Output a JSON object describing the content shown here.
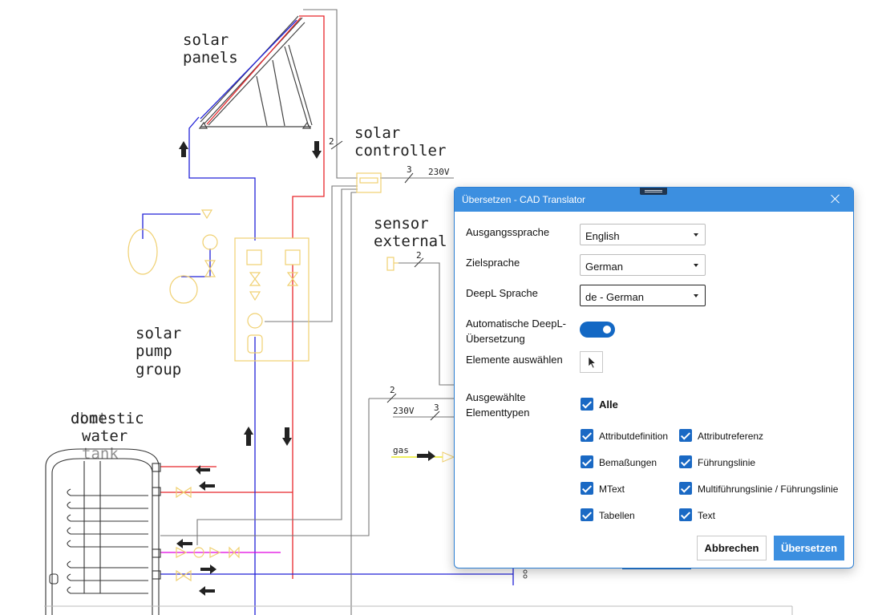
{
  "drawing": {
    "labels": {
      "solar_panels": [
        "solar",
        "panels"
      ],
      "solar_controller": [
        "solar",
        "controller"
      ],
      "sensor_external": [
        "sensor",
        "external"
      ],
      "solar_pump_group": [
        "solar",
        "pump",
        "group"
      ],
      "domestic_water_tank": [
        "domestic",
        "water",
        "tank"
      ],
      "overlap_text": "dbot"
    },
    "wire_marks": {
      "controller_wire_count": "2",
      "supply_wire_count": "3",
      "supply_voltage": "230V",
      "sensor_wire_count": "2",
      "lower_wire_count_a": "2",
      "lower_wire_count_b": "3",
      "lower_voltage": "230V",
      "gas_label": "gas"
    },
    "colors": {
      "supply_line": "#e8262b",
      "return_line": "#2222d8",
      "hot_water_line": "#e000e0",
      "symbol_yellow": "#f0d070",
      "wire_gray": "#777777"
    }
  },
  "dialog": {
    "title": "Übersetzen - CAD Translator",
    "source_language": {
      "label": "Ausgangssprache",
      "value": "English"
    },
    "target_language": {
      "label": "Zielsprache",
      "value": "German"
    },
    "deepl_language": {
      "label": "DeepL Sprache",
      "value": "de - German"
    },
    "auto_deepl": {
      "label_line1": "Automatische DeepL-",
      "label_line2": "Übersetzung",
      "enabled": true
    },
    "select_elements": {
      "label": "Elemente auswählen",
      "icon": "cursor-arrow-icon"
    },
    "element_types": {
      "label_line1": "Ausgewählte",
      "label_line2": "Elementtypen",
      "all": {
        "label": "Alle",
        "checked": true
      },
      "items": [
        {
          "label": "Attributdefinition",
          "checked": true
        },
        {
          "label": "Attributreferenz",
          "checked": true
        },
        {
          "label": "Bemaßungen",
          "checked": true
        },
        {
          "label": "Führungslinie",
          "checked": true
        },
        {
          "label": "MText",
          "checked": true
        },
        {
          "label": "Multiführungslinie / Führungslinie",
          "checked": true
        },
        {
          "label": "Tabellen",
          "checked": true
        },
        {
          "label": "Text",
          "checked": true
        }
      ]
    },
    "cancel_label": "Abbrechen",
    "translate_label": "Übersetzen",
    "accent_color": "#3c8fe0"
  }
}
